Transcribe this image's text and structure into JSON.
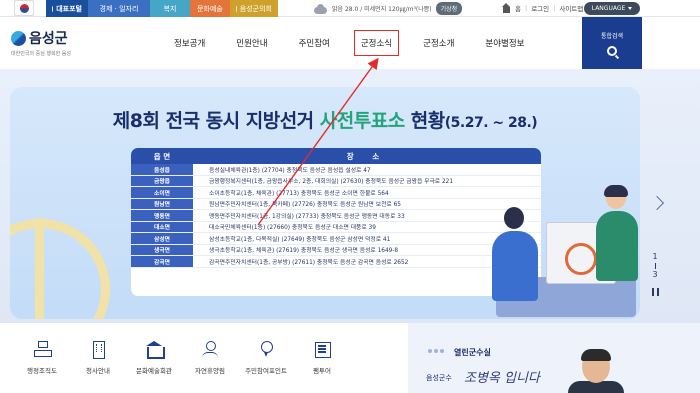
{
  "topbar": {
    "tabs": [
      "대표포털",
      "경제 · 일자리",
      "복지",
      "문화예술",
      "음성군의회"
    ],
    "weather_text": "맑음 28.0 / 미세먼지 120㎍/m³(나쁨)",
    "weather_button": "기상청",
    "util_links": [
      "홈",
      "로그인",
      "사이트맵"
    ],
    "language_label": "LANGUAGE"
  },
  "header": {
    "logo_title": "음성군",
    "logo_subtitle": "대한민국의 중심 행복한 음성",
    "nav": [
      "정보공개",
      "민원안내",
      "주민참여",
      "군정소식",
      "군정소개",
      "분야별정보"
    ],
    "active_nav": "군정소식",
    "search_label": "통합검색"
  },
  "banner": {
    "title_prefix": "제8회 전국 동시 지방선거 ",
    "title_highlight": "사전투표소",
    "title_suffix": " 현황",
    "title_dates": "(5.27. ~ 28.)",
    "table_headers": [
      "읍 면",
      "장 소"
    ],
    "rows": [
      {
        "area": "음성읍",
        "place": "음성실내체육관(1층) (27704) 충청북도 음성군 음성읍 설성로 47"
      },
      {
        "area": "금왕읍",
        "place": "금왕행정복지센터(1층, 금왕읍사무소, 2층, 대회의실) (27630) 충청북도 음성군 금왕읍 무극로 221"
      },
      {
        "area": "소이면",
        "place": "소이초등학교(1층, 체육관) (27713) 충청북도 음성군 소이면 한불로 564"
      },
      {
        "area": "원남면",
        "place": "원남면주민자치센터(1층, 북카페) (27726) 충청북도 음성군 원남면 보천로 65"
      },
      {
        "area": "맹동면",
        "place": "맹동면주민자치센터(1층, 1강의실) (27733) 충청북도 음성군 맹동면 대동로 33"
      },
      {
        "area": "대소면",
        "place": "대소국민체육센터(1층) (27660) 충청북도 음성군 대소면 대풍로 39"
      },
      {
        "area": "삼성면",
        "place": "삼성초등학교(1층, 다목적실) (27649) 충청북도 음성군 삼성면 덕정로 41"
      },
      {
        "area": "생극면",
        "place": "생극초등학교(1층, 체육관) (27619) 충청북도 음성군 생극면 음성로 1649-8"
      },
      {
        "area": "감곡면",
        "place": "감곡면주민자치센터(1층, 공부방) (27611) 충청북도 음성군 감곡면 음성로 2652"
      }
    ],
    "pager_current": "1",
    "pager_total": "3"
  },
  "quick_menu": [
    "행정조직도",
    "청사안내",
    "문화예술회관",
    "자연휴양림",
    "주민참여포인트",
    "팸투어"
  ],
  "mayor": {
    "section_title": "열린군수실",
    "name_label": "음성군수",
    "signature": "조병옥 입니다"
  },
  "colors": {
    "brand_blue": "#1b3d8f",
    "highlight_green": "#24a37a",
    "annotation_red": "#e32b2b"
  }
}
